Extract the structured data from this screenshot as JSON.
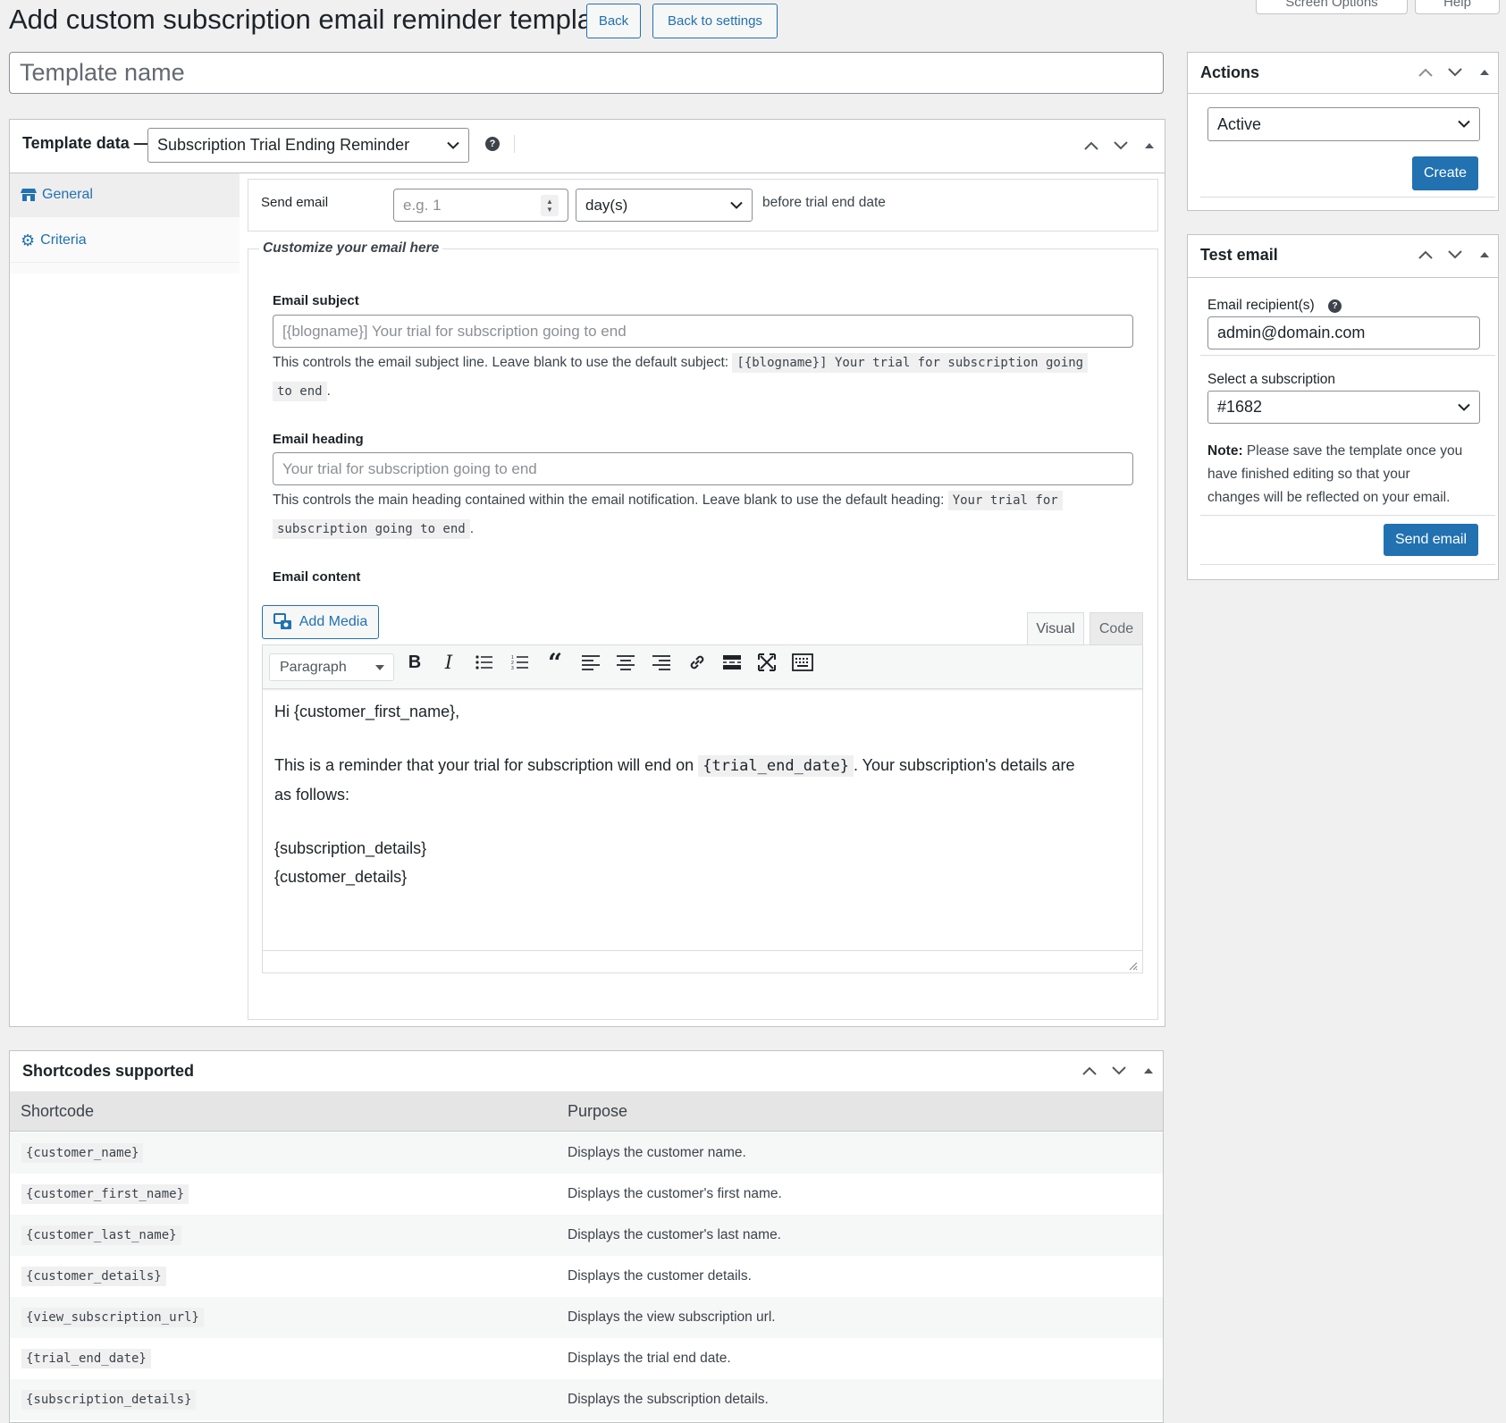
{
  "page": {
    "title": "Add custom subscription email reminder template",
    "back_label": "Back",
    "back_to_settings_label": "Back to settings",
    "screen_options_label": "Screen Options",
    "help_label": "Help"
  },
  "template_name": {
    "placeholder": "Template name"
  },
  "template_data": {
    "title": "Template data —",
    "selected_template": "Subscription Trial Ending Reminder",
    "tabs": [
      {
        "label": "General",
        "icon": "store-icon"
      },
      {
        "label": "Criteria",
        "icon": "gear-icon"
      }
    ],
    "send_email": {
      "label": "Send email",
      "number_placeholder": "e.g. 1",
      "unit_value": "day(s)",
      "suffix": "before trial end date"
    },
    "customize_legend": "Customize your email here",
    "subject": {
      "label": "Email subject",
      "placeholder": "[{blogname}] Your trial for subscription going to end",
      "desc_text": "This controls the email subject line. Leave blank to use the default subject:",
      "default_part1": "[{blogname}] Your trial for subscription going",
      "default_part2": "to end",
      "desc_end": "."
    },
    "heading": {
      "label": "Email heading",
      "placeholder": "Your trial for subscription going to end",
      "desc_text": "This controls the main heading contained within the email notification. Leave blank to use the default heading:",
      "default_part1": "Your trial for",
      "default_part2": "subscription going to end",
      "desc_end": "."
    },
    "content": {
      "label": "Email content",
      "add_media_label": "Add Media",
      "tab_visual": "Visual",
      "tab_code": "Code",
      "format_value": "Paragraph",
      "line1": "Hi {customer_first_name},",
      "line2_before": "This is a reminder that your trial for subscription will end on",
      "line2_code": "{trial_end_date}",
      "line2_after": ". Your subscription's details are",
      "line3": "as follows:",
      "line4": "{subscription_details}",
      "line5": "{customer_details}"
    }
  },
  "actions": {
    "title": "Actions",
    "status_value": "Active",
    "create_label": "Create"
  },
  "test_email": {
    "title": "Test email",
    "recipient_label": "Email recipient(s)",
    "recipient_value": "admin@domain.com",
    "subscription_label": "Select a subscription",
    "subscription_value": "#1682",
    "note_bold": "Note:",
    "note_line1": "Please save the template once you",
    "note_line2": "have finished editing so that your",
    "note_line3": "changes will be reflected on your email.",
    "send_label": "Send email"
  },
  "shortcodes": {
    "title": "Shortcodes supported",
    "col_shortcode": "Shortcode",
    "col_purpose": "Purpose",
    "rows": [
      {
        "code": "{customer_name}",
        "purpose": "Displays the customer name."
      },
      {
        "code": "{customer_first_name}",
        "purpose": "Displays the customer's first name."
      },
      {
        "code": "{customer_last_name}",
        "purpose": "Displays the customer's last name."
      },
      {
        "code": "{customer_details}",
        "purpose": "Displays the customer details."
      },
      {
        "code": "{view_subscription_url}",
        "purpose": "Displays the view subscription url."
      },
      {
        "code": "{trial_end_date}",
        "purpose": "Displays the trial end date."
      },
      {
        "code": "{subscription_details}",
        "purpose": "Displays the subscription details."
      }
    ]
  },
  "colors": {
    "accent": "#2271b1",
    "border": "#c3c4c7",
    "bg": "#f0f0f1"
  }
}
